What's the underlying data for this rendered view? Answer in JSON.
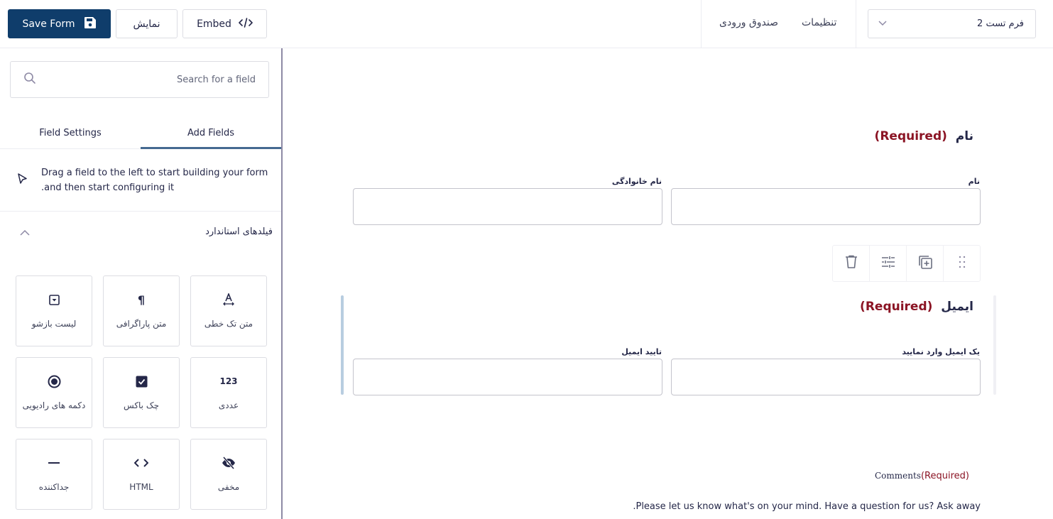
{
  "topbar": {
    "save_label": "Save Form",
    "preview_label": "نمایش",
    "embed_label": "Embed",
    "links": [
      "صندوق ورودی",
      "تنظیمات"
    ],
    "form_selector": "فرم تست 2",
    "icons": {
      "save": "floppy-disk-icon",
      "embed": "code-icon",
      "select": "chevron-down-icon"
    }
  },
  "sidebar": {
    "search_placeholder": "Search for a field",
    "tabs": [
      {
        "label": "Field Settings",
        "active": false
      },
      {
        "label": "Add Fields",
        "active": true
      }
    ],
    "hint_line1": "Drag a field to the left to start building your form",
    "hint_line2": ".and then start configuring it",
    "section_title": "فیلدهای استاندارد",
    "fields": [
      {
        "label": "متن تک خطی",
        "icon": "text-icon"
      },
      {
        "label": "متن پاراگرافی",
        "icon": "paragraph-icon"
      },
      {
        "label": "لیست بازشو",
        "icon": "dropdown-icon"
      },
      {
        "label": "عددی",
        "icon": "number-icon",
        "glyph": "123"
      },
      {
        "label": "چک باکس",
        "icon": "checkbox-icon"
      },
      {
        "label": "دکمه های رادیویی",
        "icon": "radio-icon"
      },
      {
        "label": "مخفی",
        "icon": "hidden-icon"
      },
      {
        "label": "HTML",
        "icon": "html-icon"
      },
      {
        "label": "جداکننده",
        "icon": "divider-icon"
      }
    ]
  },
  "canvas": {
    "name_group": {
      "title": "نام",
      "required": "(Required)",
      "first_label": "نام",
      "last_label": "نام خانوادگی"
    },
    "email_group": {
      "title": "ایمیل",
      "required": "(Required)",
      "email_label": "یک ایمیل وارد نمایید",
      "confirm_label": "تایید ایمیل"
    },
    "field_toolbar": [
      "drag-handle",
      "duplicate",
      "settings",
      "delete"
    ],
    "comments": {
      "label": "Comments",
      "required": "(Required)",
      "description": ".Please let us know what's on your mind. Have a question for us? Ask away"
    }
  },
  "colors": {
    "primary": "#0f3d6b",
    "required": "#8b1424",
    "tab_active": "#456a91",
    "selection": "#b8cde0"
  }
}
